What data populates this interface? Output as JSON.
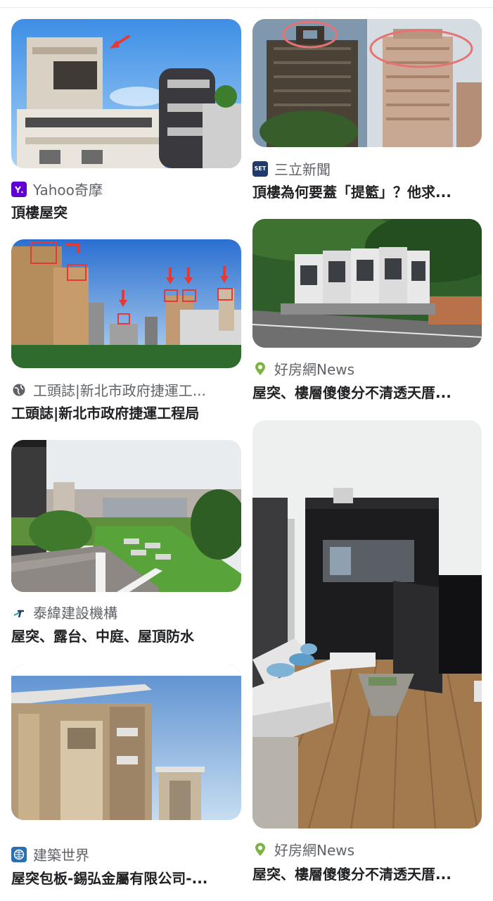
{
  "results": [
    {
      "source": "Yahoo奇摩",
      "title": "頂樓屋突",
      "favicon": "yahoo-icon",
      "favicon_color": "#6001d2"
    },
    {
      "source": "三立新聞",
      "title": "頂樓為何要蓋「提籃」？他求...",
      "favicon": "set-news-icon",
      "favicon_color": "#1f3a6b",
      "favicon_text": "SET"
    },
    {
      "source": "工頭誌|新北市政府捷運工...",
      "title": "工頭誌|新北市政府捷運工程局",
      "favicon": "globe-icon",
      "favicon_color": "#5f6368"
    },
    {
      "source": "好房網News",
      "title": "屋突、樓層傻傻分不清透天厝...",
      "favicon": "map-pin-icon",
      "favicon_color": "#7cb342"
    },
    {
      "source": "泰緯建設機構",
      "title": "屋突、露台、中庭、屋頂防水",
      "favicon": "taiwei-logo-icon",
      "favicon_color": "#1fa398"
    },
    {
      "source": "建築世界",
      "title": "屋突包板-錫弘金屬有限公司-...",
      "favicon": "building-world-icon",
      "favicon_color": "#2a6fb0"
    },
    {
      "source": "好房網News",
      "title": "屋突、樓層傻傻分不清透天厝...",
      "favicon": "map-pin-icon",
      "favicon_color": "#7cb342"
    }
  ]
}
